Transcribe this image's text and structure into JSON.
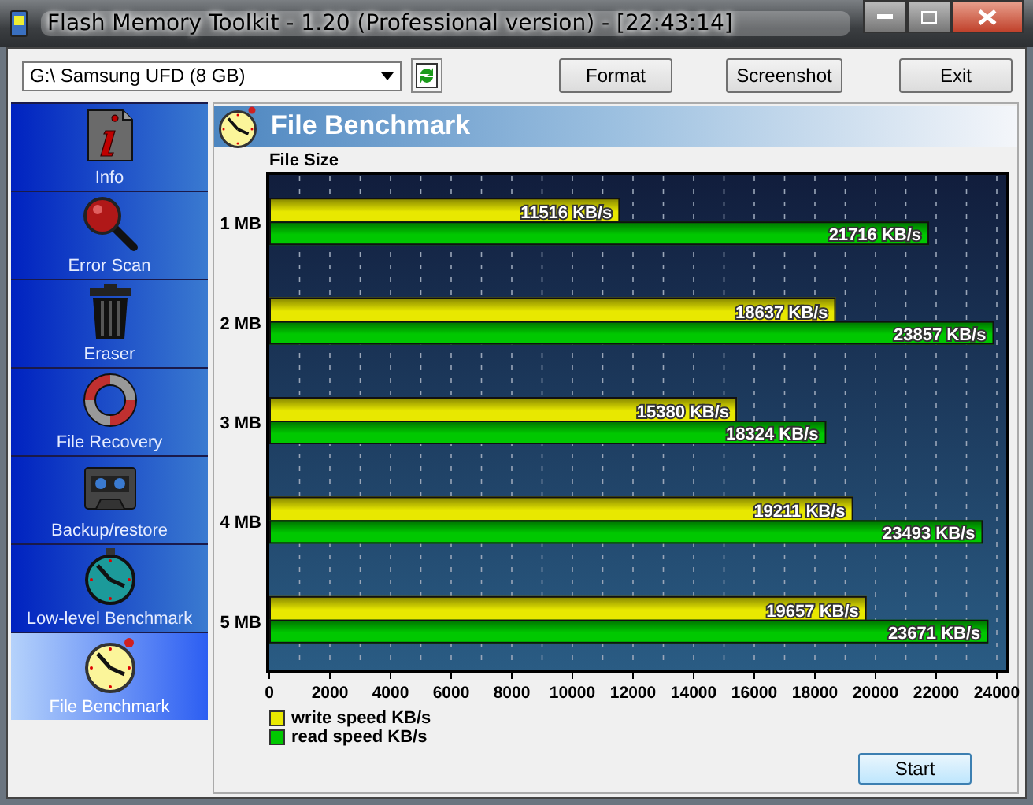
{
  "window": {
    "title": "Flash Memory Toolkit - 1.20 (Professional version) - [22:43:14]"
  },
  "toolbar": {
    "drive": "G:\\ Samsung UFD (8 GB)",
    "buttons": [
      "Format",
      "Screenshot",
      "Exit"
    ]
  },
  "sidebar": {
    "items": [
      {
        "label": "Info",
        "kind": "info",
        "selected": false
      },
      {
        "label": "Error Scan",
        "kind": "magnifier",
        "selected": false
      },
      {
        "label": "Eraser",
        "kind": "bin",
        "selected": false
      },
      {
        "label": "File Recovery",
        "kind": "lifebuoy",
        "selected": false
      },
      {
        "label": "Backup/restore",
        "kind": "tape",
        "selected": false
      },
      {
        "label": "Low-level Benchmark",
        "kind": "stopwatch-teal",
        "selected": false
      },
      {
        "label": "File Benchmark",
        "kind": "stopwatch-yellow",
        "selected": true
      }
    ]
  },
  "panel": {
    "title": "File Benchmark",
    "start_button": "Start",
    "chart_data": {
      "type": "bar",
      "orientation": "horizontal",
      "ylabel": "File Size",
      "categories": [
        "1 MB",
        "2 MB",
        "3 MB",
        "4 MB",
        "5 MB"
      ],
      "series": [
        {
          "name": "write speed KB/s",
          "color": "#e8e800",
          "values": [
            11516,
            18637,
            15380,
            19211,
            19657
          ]
        },
        {
          "name": "read speed KB/s",
          "color": "#00c800",
          "values": [
            21716,
            23857,
            18324,
            23493,
            23671
          ]
        }
      ],
      "value_labels": [
        [
          "11516 KB/s",
          "18637 KB/s",
          "15380 KB/s",
          "19211 KB/s",
          "19657 KB/s"
        ],
        [
          "21716 KB/s",
          "23857 KB/s",
          "18324 KB/s",
          "23493 KB/s",
          "23671 KB/s"
        ]
      ],
      "xlim": [
        0,
        24000
      ],
      "xticks": [
        0,
        2000,
        4000,
        6000,
        8000,
        10000,
        12000,
        14000,
        16000,
        18000,
        20000,
        22000,
        24000
      ],
      "grid": true
    }
  }
}
